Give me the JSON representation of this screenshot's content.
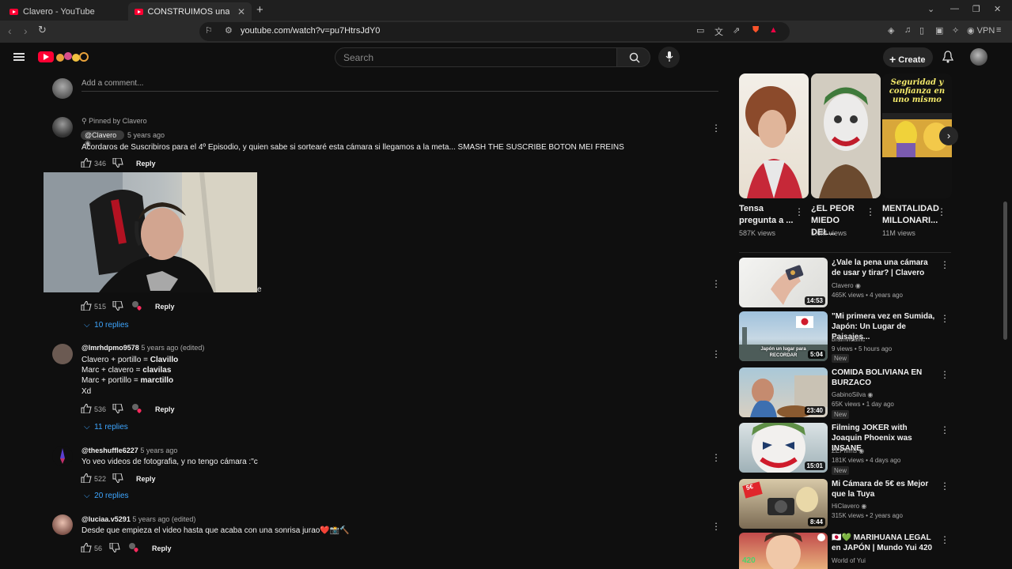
{
  "browser": {
    "tabs": [
      {
        "title": "Clavero - YouTube"
      },
      {
        "title": "CONSTRUIMOS una CÁMARA"
      }
    ],
    "url": "youtube.com/watch?v=pu7HtrsJdY0",
    "vpn_label": "VPN"
  },
  "header": {
    "search_placeholder": "Search",
    "create_label": "Create"
  },
  "comments": {
    "add_placeholder": "Add a comment...",
    "items": [
      {
        "pinned_label": "Pinned by Clavero",
        "handle": "@Clavero",
        "time": "5 years ago",
        "text": "Acordaros de Suscribiros para el 4º Episodio, y quien sabe si sortearé esta cámara si llegamos a la meta... SMASH THE SUSCRIBE BOTON MEI FREINS",
        "likes": "346",
        "reply_label": "Reply"
      },
      {
        "likes": "515",
        "reply_label": "Reply",
        "replies_label": "10 replies"
      },
      {
        "handle": "@lmrhdpmo9578",
        "time": "5 years ago (edited)",
        "lines": [
          {
            "a": "Clavero + portillo = ",
            "b": "Clavillo"
          },
          {
            "a": "Marc + clavero = ",
            "b": "clavilas"
          },
          {
            "a": "Marc + portillo = ",
            "b": "marctillo"
          },
          {
            "a": "Xd",
            "b": ""
          }
        ],
        "likes": "536",
        "reply_label": "Reply",
        "replies_label": "11 replies"
      },
      {
        "handle": "@theshuffle6227",
        "time": "5 years ago",
        "text": "Yo veo videos de fotografia, y no tengo cámara :\"c",
        "likes": "522",
        "reply_label": "Reply",
        "replies_label": "20 replies"
      },
      {
        "handle": "@luciaa.v5291",
        "time": "5 years ago (edited)",
        "text": "Desde que empieza el video hasta que acaba con una sonrisa jurao❤️📸🔨",
        "likes": "56",
        "reply_label": "Reply"
      }
    ]
  },
  "shorts": [
    {
      "title": "Tensa pregunta a ...",
      "views": "587K views"
    },
    {
      "title": "¿EL PEOR MIEDO DEL...",
      "views": "1.6M views"
    },
    {
      "title": "MENTALIDAD MILLONARI...",
      "views": "11M views",
      "overlay": "Seguridad y confianza en uno mismo"
    }
  ],
  "recommendations": [
    {
      "title": "¿Vale la pena una cámara de usar y tirar? | Clavero",
      "channel": "Clavero",
      "views": "465K views",
      "age": "4 years ago",
      "duration": "14:53",
      "verified": true,
      "new": false
    },
    {
      "title": "\"Mi primera vez en Sumida, Japón: Un Lugar de Paisajes...",
      "channel": "brainvidalfic",
      "views": "9 views",
      "age": "5 hours ago",
      "duration": "5:04",
      "verified": false,
      "new": true,
      "thumb_text": "Japón un lugar para RECORDAR"
    },
    {
      "title": "COMIDA BOLIVIANA EN BURZACO",
      "channel": "GabinoSilva",
      "views": "65K views",
      "age": "1 day ago",
      "duration": "23:40",
      "verified": true,
      "new": true
    },
    {
      "title": "Filming JOKER with Joaquin Phoenix was INSANE",
      "channel": "ZEPfilms",
      "views": "181K views",
      "age": "4 days ago",
      "duration": "15:01",
      "verified": true,
      "new": true
    },
    {
      "title": "Mi Cámara de 5€ es Mejor que la Tuya",
      "channel": "HiClavero",
      "views": "315K views",
      "age": "2 years ago",
      "duration": "8:44",
      "verified": true,
      "new": false,
      "thumb_text": "5€"
    },
    {
      "title": "🇯🇵💚 MARIHUANA LEGAL en JAPÓN | Mundo Yui 420",
      "channel": "World of Yui",
      "views": "",
      "age": "",
      "duration": "",
      "verified": false,
      "new": false,
      "thumb_text": "420"
    }
  ],
  "colors": {
    "accent": "#ff0033",
    "link": "#3ea6ff",
    "bg": "#0f0f0f"
  }
}
